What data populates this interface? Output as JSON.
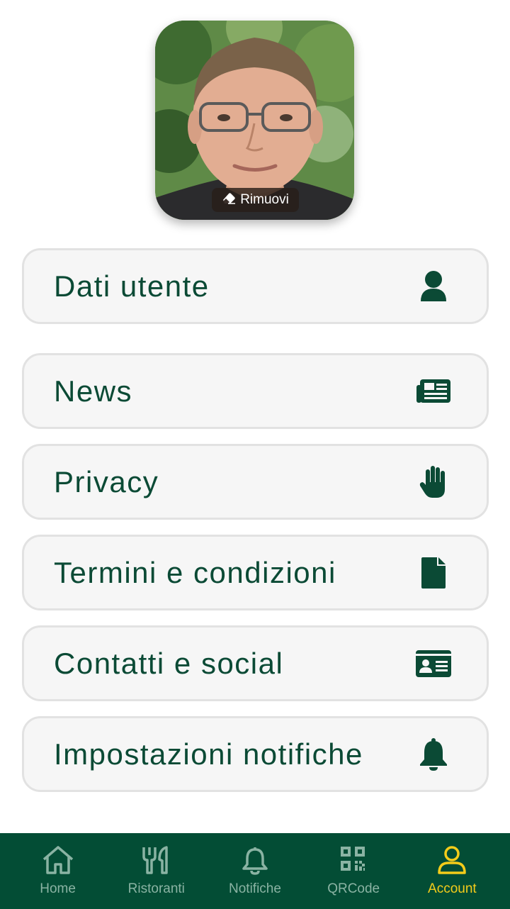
{
  "avatar": {
    "remove_label": "Rimuovi"
  },
  "menu": [
    {
      "label": "Dati utente",
      "icon": "user-icon"
    },
    {
      "label": "News",
      "icon": "newspaper-icon"
    },
    {
      "label": "Privacy",
      "icon": "hand-icon"
    },
    {
      "label": "Termini e condizioni",
      "icon": "file-icon"
    },
    {
      "label": "Contatti e social",
      "icon": "id-card-icon"
    },
    {
      "label": "Impostazioni notifiche",
      "icon": "bell-icon"
    }
  ],
  "nav": {
    "items": [
      {
        "label": "Home",
        "icon": "home-icon"
      },
      {
        "label": "Ristoranti",
        "icon": "utensils-icon"
      },
      {
        "label": "Notifiche",
        "icon": "bell-outline-icon"
      },
      {
        "label": "QRCode",
        "icon": "qrcode-icon"
      },
      {
        "label": "Account",
        "icon": "account-icon"
      }
    ],
    "active": "Account",
    "colors": {
      "background": "#034d35",
      "inactive": "#8ab3a3",
      "active": "#f4cc1a"
    }
  },
  "colors": {
    "primary": "#0b4a35",
    "card_bg": "#f6f6f6",
    "card_border": "#e2e2e2"
  }
}
